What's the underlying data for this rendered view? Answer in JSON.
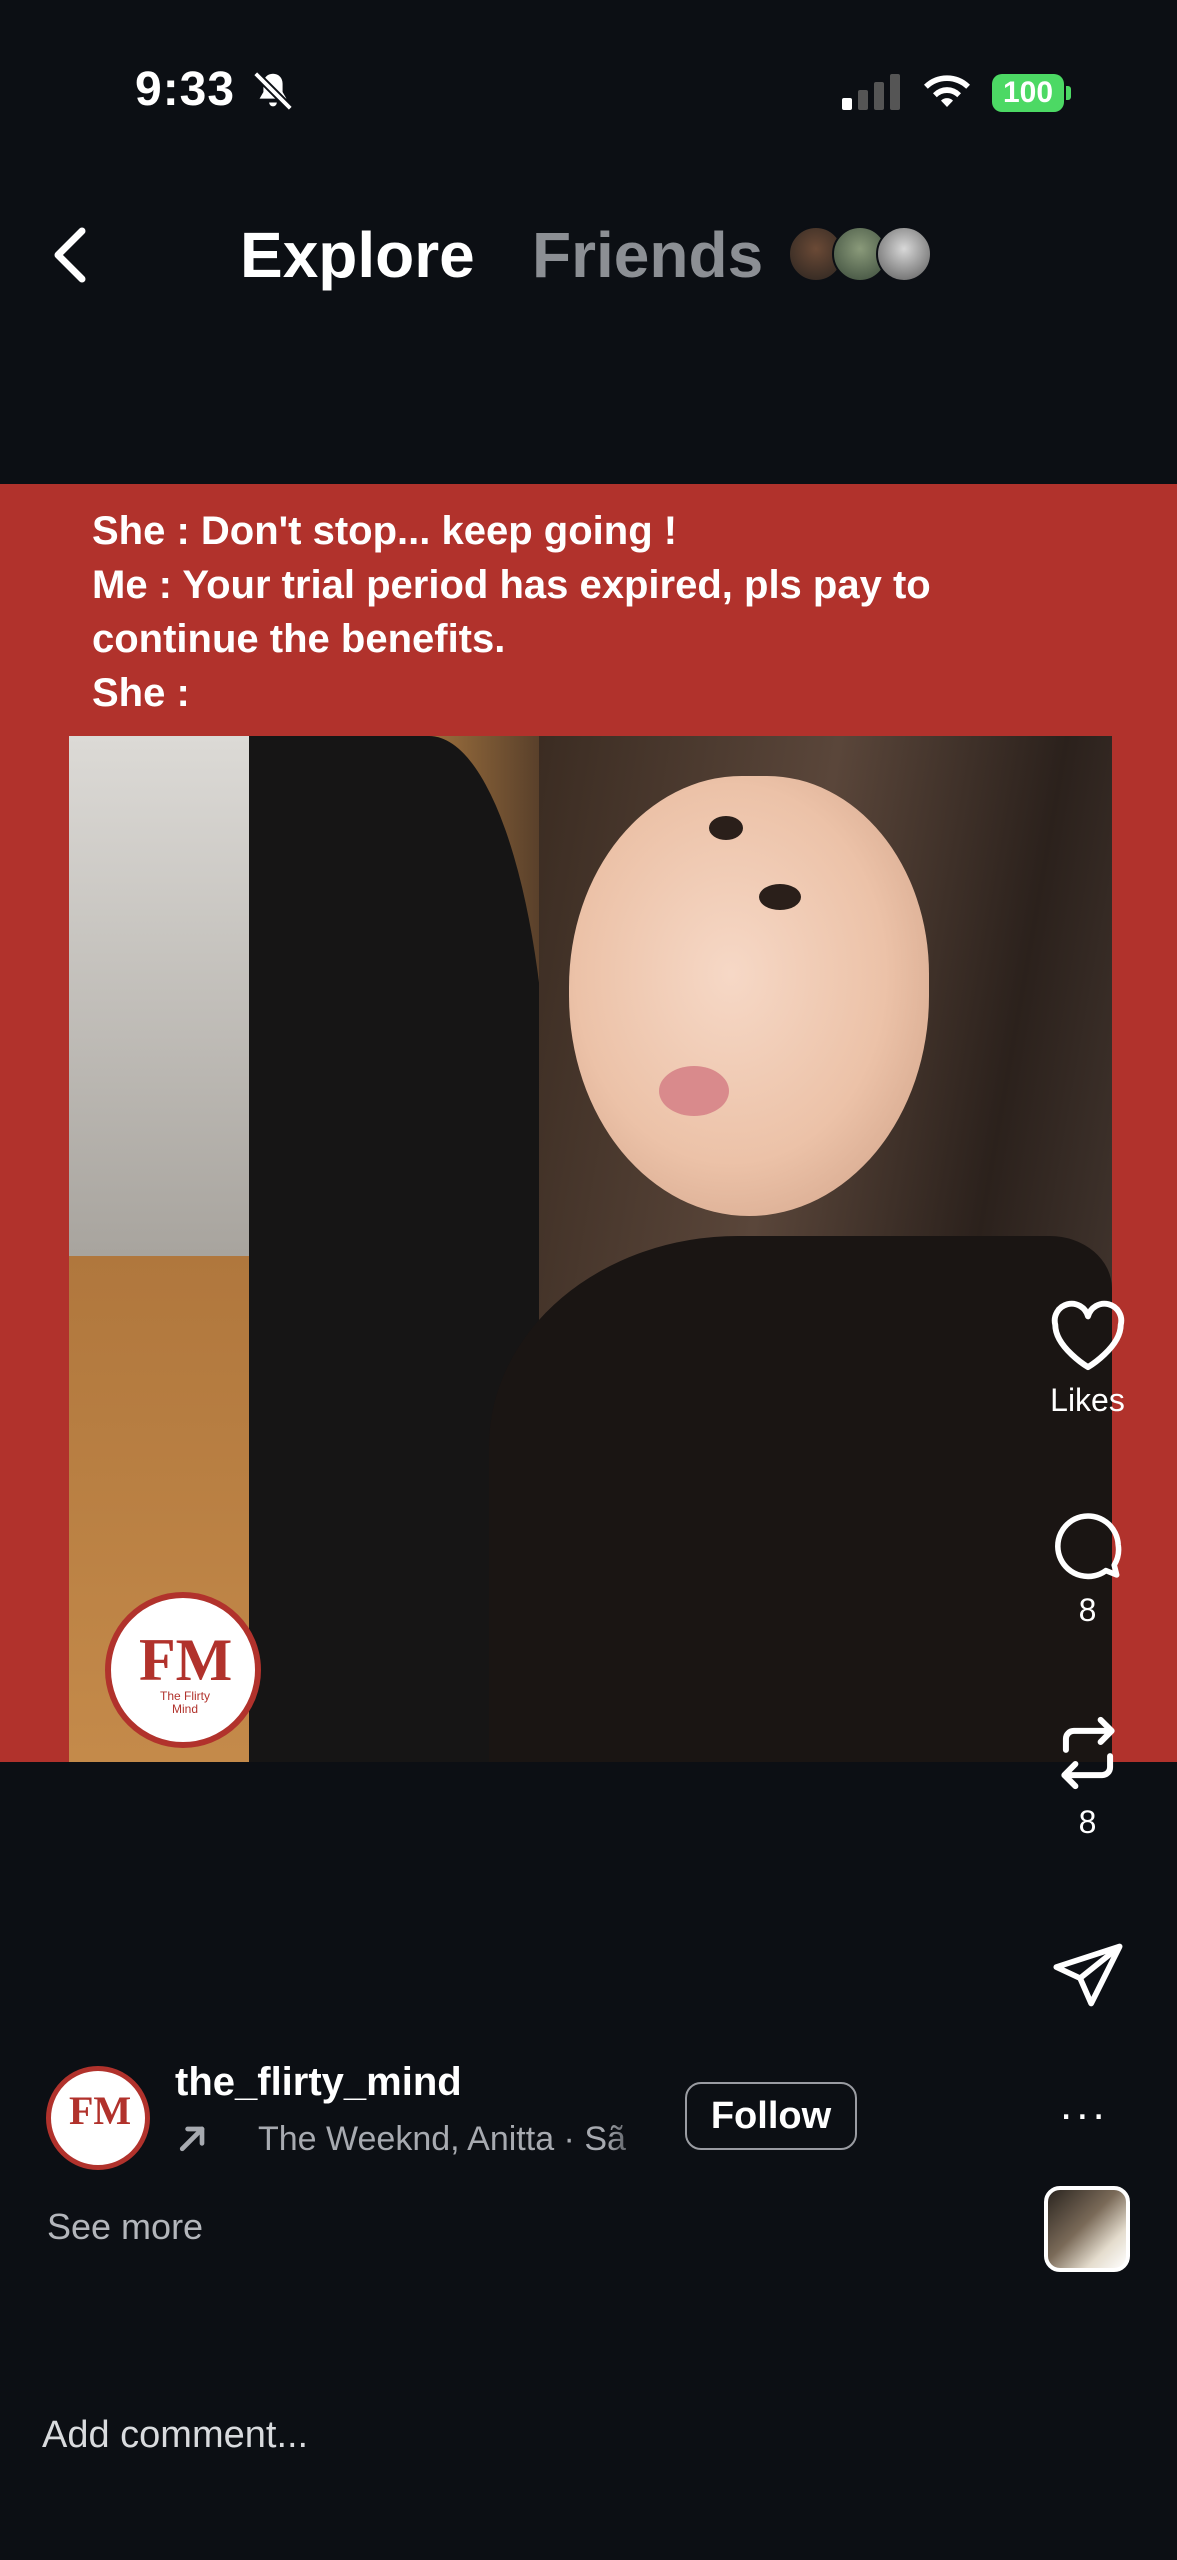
{
  "status_bar": {
    "time": "9:33",
    "battery": "100"
  },
  "header": {
    "tabs": [
      {
        "label": "Explore",
        "active": true
      },
      {
        "label": "Friends",
        "active": false
      }
    ]
  },
  "post": {
    "caption_lines": [
      "She : Don't stop... keep going !",
      "Me : Your trial period has expired, pls pay to",
      "continue the benefits.",
      "She :"
    ],
    "logo_text": "FM",
    "logo_subtext": "The Flirty Mind",
    "username": "the_flirty_mind",
    "music": "The Weeknd, Anitta · Sã",
    "follow_label": "Follow",
    "see_more_label": "See more",
    "more_label": "..."
  },
  "actions": {
    "likes_label": "Likes",
    "comments_count": "8",
    "reposts_count": "8"
  },
  "comment": {
    "placeholder": "Add comment..."
  },
  "colors": {
    "accent_red": "#b1322c",
    "background": "#0c0f14",
    "battery_green": "#4cd964"
  }
}
